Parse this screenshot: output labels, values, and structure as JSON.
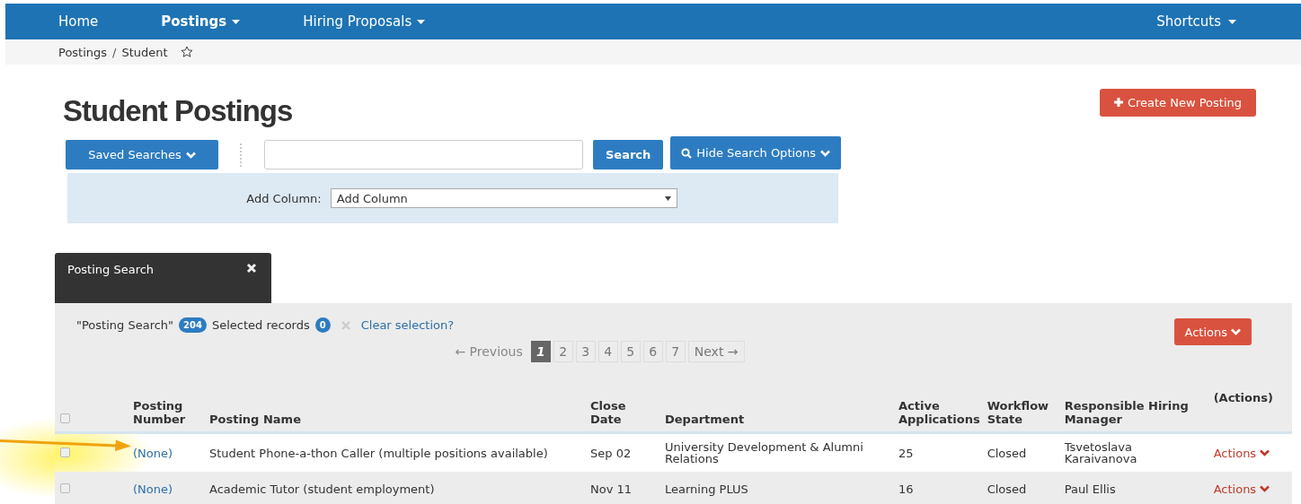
{
  "nav": {
    "items": [
      {
        "label": "Home",
        "selected": false,
        "dropdown": false
      },
      {
        "label": "Postings",
        "selected": true,
        "dropdown": true
      },
      {
        "label": "Hiring Proposals",
        "selected": false,
        "dropdown": true
      }
    ],
    "shortcuts": "Shortcuts"
  },
  "breadcrumb": {
    "items": [
      "Postings",
      "Student"
    ],
    "separator": "/"
  },
  "title": "Student Postings",
  "create_button": "Create New Posting",
  "search": {
    "saved_searches": "Saved Searches",
    "button": "Search",
    "toggle": "Hide Search Options"
  },
  "add_column": {
    "label": "Add Column:",
    "value": "Add Column"
  },
  "results_tab": {
    "title": "Posting Search"
  },
  "summary": {
    "search_name": "\"Posting Search\"",
    "count": "204",
    "selected_label": "Selected records",
    "selected_count": "0",
    "clear": "Clear selection?"
  },
  "actions_button": "Actions",
  "pagination": {
    "previous": "← Previous",
    "next": "Next →",
    "pages": [
      {
        "label": "1",
        "selected": true
      },
      {
        "label": "2",
        "selected": false
      },
      {
        "label": "3",
        "selected": false
      },
      {
        "label": "4",
        "selected": false
      },
      {
        "label": "5",
        "selected": false
      },
      {
        "label": "6",
        "selected": false
      },
      {
        "label": "7",
        "selected": false
      }
    ]
  },
  "table": {
    "columns": [
      "Posting Number",
      "Posting Name",
      "Close Date",
      "Department",
      "Active Applications",
      "Workflow State",
      "Responsible Hiring Manager",
      "(Actions)"
    ],
    "header_checked": false,
    "rows": [
      {
        "checked": false,
        "number": "(None)",
        "name": "Student Phone-a-thon Caller (multiple positions available)",
        "close_date": "Sep 02",
        "department": "University Development & Alumni Relations",
        "applications": "25",
        "state": "Closed",
        "manager": "Tsvetoslava Karaivanova",
        "action": "Actions"
      },
      {
        "checked": false,
        "number": "(None)",
        "name": "Academic Tutor (student employment)",
        "close_date": "Nov 11",
        "department": "Learning PLUS",
        "applications": "16",
        "state": "Closed",
        "manager": "Paul Ellis",
        "action": "Actions"
      }
    ]
  }
}
